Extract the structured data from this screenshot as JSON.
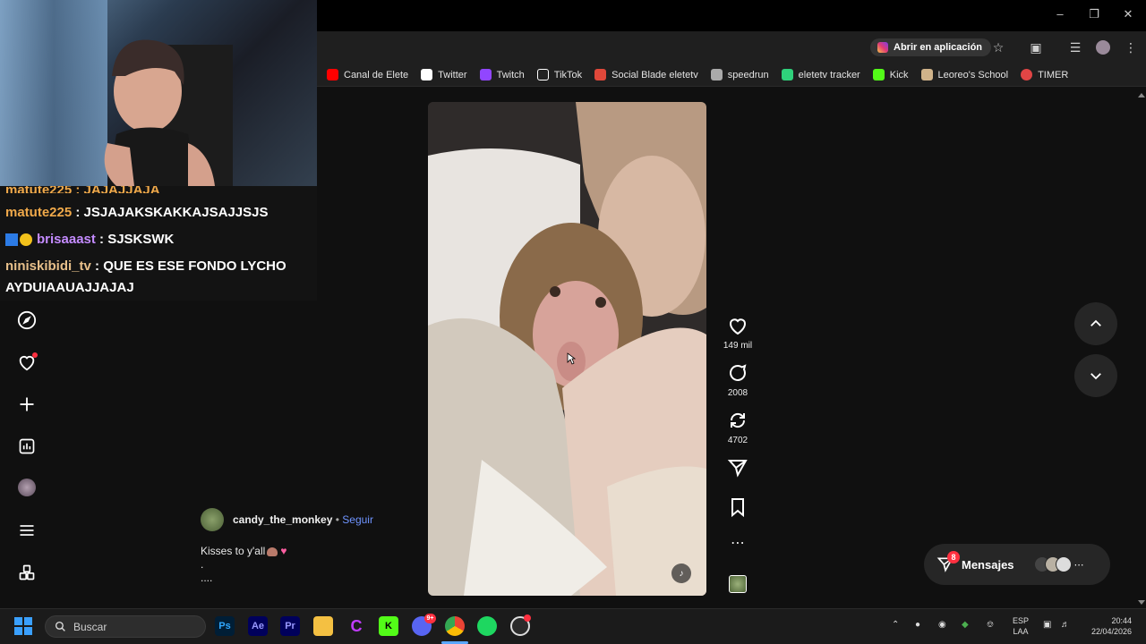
{
  "browser": {
    "open_in_app_label": "Abrir en aplicación",
    "bookmarks": [
      {
        "label": "Canal de Elete",
        "icon": "youtube-icon",
        "color": "#ff0000"
      },
      {
        "label": "Twitter",
        "icon": "x-icon",
        "color": "#ffffff"
      },
      {
        "label": "Twitch",
        "icon": "twitch-icon",
        "color": "#9146ff"
      },
      {
        "label": "TikTok",
        "icon": "tiktok-icon",
        "color": "#ffffff"
      },
      {
        "label": "Social Blade eletetv",
        "icon": "socialblade-icon",
        "color": "#e0483a"
      },
      {
        "label": "speedrun",
        "icon": "speedrun-icon",
        "color": "#aaaaaa"
      },
      {
        "label": "eletetv tracker",
        "icon": "tracker-icon",
        "color": "#2fd17b"
      },
      {
        "label": "Kick",
        "icon": "kick-icon",
        "color": "#53fc18"
      },
      {
        "label": "Leoreo's School",
        "icon": "school-icon",
        "color": "#d0b38a"
      },
      {
        "label": "TIMER",
        "icon": "timer-icon",
        "color": "#e24545"
      }
    ]
  },
  "chat": {
    "partial_line": "matute225 : JAJAJJAJA",
    "messages": [
      {
        "user": "matute225",
        "text": " : JSJAJAKSKAKKAJSAJJSJS"
      },
      {
        "user": "brisaaast",
        "text": " : SJSKSWK"
      },
      {
        "user": "niniskibidi_tv",
        "text": " : QUE ES ESE FONDO LYCHO",
        "text2": "AYDUIAAUAJJAJAJ"
      }
    ]
  },
  "post": {
    "author": "candy_the_monkey",
    "separator": " • ",
    "follow": "Seguir",
    "caption_line1": "Kisses to y'all",
    "caption_line2": ".",
    "caption_line3": "...."
  },
  "actions": {
    "likes": "149 mil",
    "comments": "2008",
    "reposts": "4702"
  },
  "messages": {
    "label": "Mensajes",
    "badge": "8"
  },
  "taskbar": {
    "search_placeholder": "Buscar",
    "lang": "ESP",
    "layout": "LAA",
    "time": "20:44",
    "date": "22/04/2026",
    "discord_badge": "9+"
  }
}
